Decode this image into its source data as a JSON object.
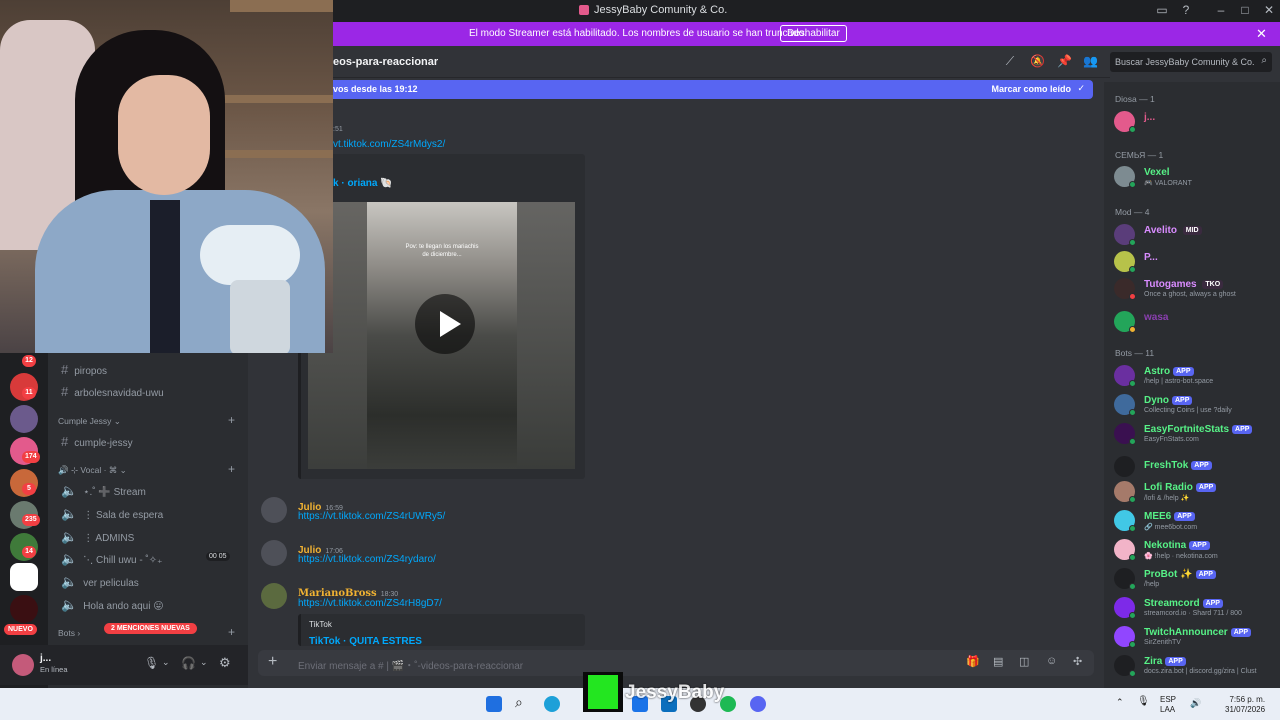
{
  "window": {
    "title": "JessyBaby Comunity & Co."
  },
  "banner": {
    "message": "El modo Streamer está habilitado. Los nombres de usuario se han truncado.",
    "button": "Deshabilitar",
    "close": "✕"
  },
  "channel": {
    "name": "eos-para-reaccionar"
  },
  "search": {
    "placeholder": "Buscar JessyBaby Comunity & Co."
  },
  "newbar": {
    "left": "vos desde las 19:12",
    "right": "Marcar como leído"
  },
  "messages": [
    {
      "time": ":51",
      "link": "vt.tiktok.com/ZS4rMdys2/"
    },
    {
      "embed_title": "k · oriana 🐚"
    },
    {
      "author": "Julio",
      "time": "16:59",
      "link": "https://vt.tiktok.com/ZS4rUWRy5/"
    },
    {
      "author": "Julio",
      "time": "17:06",
      "link": "https://vt.tiktok.com/ZS4rydaro/"
    },
    {
      "author": "MarianoBross",
      "time": "18:30",
      "link": "https://vt.tiktok.com/ZS4rH8gD7/",
      "embed_provider": "TikTok",
      "embed_title": "TikTok · QUITA ESTRES"
    }
  ],
  "composer": {
    "placeholder": "Enviar mensaje a # | 🎬・˚-videos-para-reaccionar"
  },
  "sidebar": {
    "channels": [
      {
        "name": "piropos"
      },
      {
        "name": "arbolesnavidad-uwu"
      }
    ],
    "category_cumple": "Cumple Jessy",
    "channel_cumple": "cumple-jessy",
    "category_vocal": "🔊 ⊹ Vocal · ⌘",
    "voice": [
      {
        "name": "⋆.˚ ➕ Stream"
      },
      {
        "name": "⋮ Sala de espera"
      },
      {
        "name": "⋮ ADMINS"
      },
      {
        "name": "⋱ Chill uwu - ˚✧₊"
      },
      {
        "name": "ver peliculas"
      },
      {
        "name": "Hola ando aqui 😛"
      }
    ],
    "chill_counts": [
      "00",
      "05"
    ],
    "category_bots": "Bots",
    "mentions_pill": "2 MENCIONES NUEVAS",
    "new_pill": "NUEVO",
    "server_badges": [
      "12",
      "11",
      "174",
      "5",
      "235",
      "14"
    ]
  },
  "user": {
    "name": "j...",
    "status": "En línea"
  },
  "members": {
    "groups": [
      {
        "label": "Diosa — 1"
      },
      {
        "label": "СЕМЬЯ — 1"
      },
      {
        "label": "Mod — 4"
      },
      {
        "label": "Bots — 11"
      }
    ],
    "list": [
      {
        "name": "j...",
        "sub": "",
        "color": "#e35a8c"
      },
      {
        "name": "Vexel",
        "sub": "🎮 VALORANT",
        "color": "#57f287"
      },
      {
        "name": "Avelito",
        "badge": "MID",
        "sub": "",
        "color": "#d98cff"
      },
      {
        "name": "P...",
        "sub": "",
        "color": "#d98cff"
      },
      {
        "name": "Tutogames",
        "badge": "TKO",
        "sub": "Once a ghost, always a ghost",
        "color": "#d98cff"
      },
      {
        "name": "wasa",
        "sub": "",
        "color": "#b34bd9"
      },
      {
        "name": "Astro",
        "app": "APP",
        "sub": "/help | astro-bot.space",
        "color": "#57f287"
      },
      {
        "name": "Dyno",
        "app": "APP",
        "sub": "Collecting Coins | use ?daily",
        "color": "#57f287"
      },
      {
        "name": "EasyFortniteStats",
        "app": "APP",
        "sub": "EasyFnStats.com",
        "color": "#57f287"
      },
      {
        "name": "FreshTok",
        "app": "APP",
        "sub": "",
        "color": "#57f287"
      },
      {
        "name": "Lofi Radio",
        "app": "APP",
        "sub": "/lofi & /help ✨",
        "color": "#57f287"
      },
      {
        "name": "MEE6",
        "app": "APP",
        "sub": "🔗 mee6bot.com",
        "color": "#57f287"
      },
      {
        "name": "Nekotina",
        "app": "APP",
        "sub": "🌸 !help · nekotina.com",
        "color": "#57f287"
      },
      {
        "name": "ProBot ✨",
        "app": "APP",
        "sub": "/help",
        "color": "#57f287"
      },
      {
        "name": "Streamcord",
        "app": "APP",
        "sub": "streamcord.io · Shard 711 / 800",
        "color": "#57f287"
      },
      {
        "name": "TwitchAnnouncer",
        "app": "APP",
        "sub": "SirZenithTV",
        "color": "#57f287"
      },
      {
        "name": "Zira",
        "app": "APP",
        "sub": "docs.zira.bot | discord.gg/zira | Clust",
        "color": "#57f287"
      }
    ]
  },
  "taskbar": {
    "lang": [
      "ESP",
      "LAA"
    ],
    "time": "7:56 p. m.",
    "date": "31/07/2026",
    "overlay_text": "JessyBaby"
  },
  "video_caption": "Pov: te llegan los mariachis de diciembre..."
}
